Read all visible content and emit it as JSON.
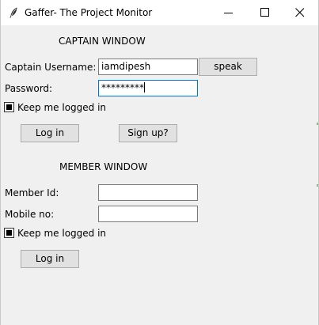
{
  "window": {
    "title": "Gaffer- The Project Monitor"
  },
  "captain": {
    "section_title": "CAPTAIN WINDOW",
    "username_label": "Captain Username:",
    "username_value": "iamdipesh",
    "speak_label": "speak",
    "password_label": "Password:",
    "password_value": "*********",
    "keep_logged_label": "Keep me logged in",
    "keep_logged_checked": true,
    "login_label": "Log in",
    "signup_label": "Sign up?"
  },
  "member": {
    "section_title": "MEMBER WINDOW",
    "member_id_label": "Member Id:",
    "member_id_value": "",
    "mobile_label": "Mobile no:",
    "mobile_value": "",
    "keep_logged_label": "Keep me logged in",
    "keep_logged_checked": true,
    "login_label": "Log in"
  },
  "icons": {
    "app": "feather-icon",
    "minimize": "minimize-icon",
    "maximize": "maximize-icon",
    "close": "close-icon"
  }
}
